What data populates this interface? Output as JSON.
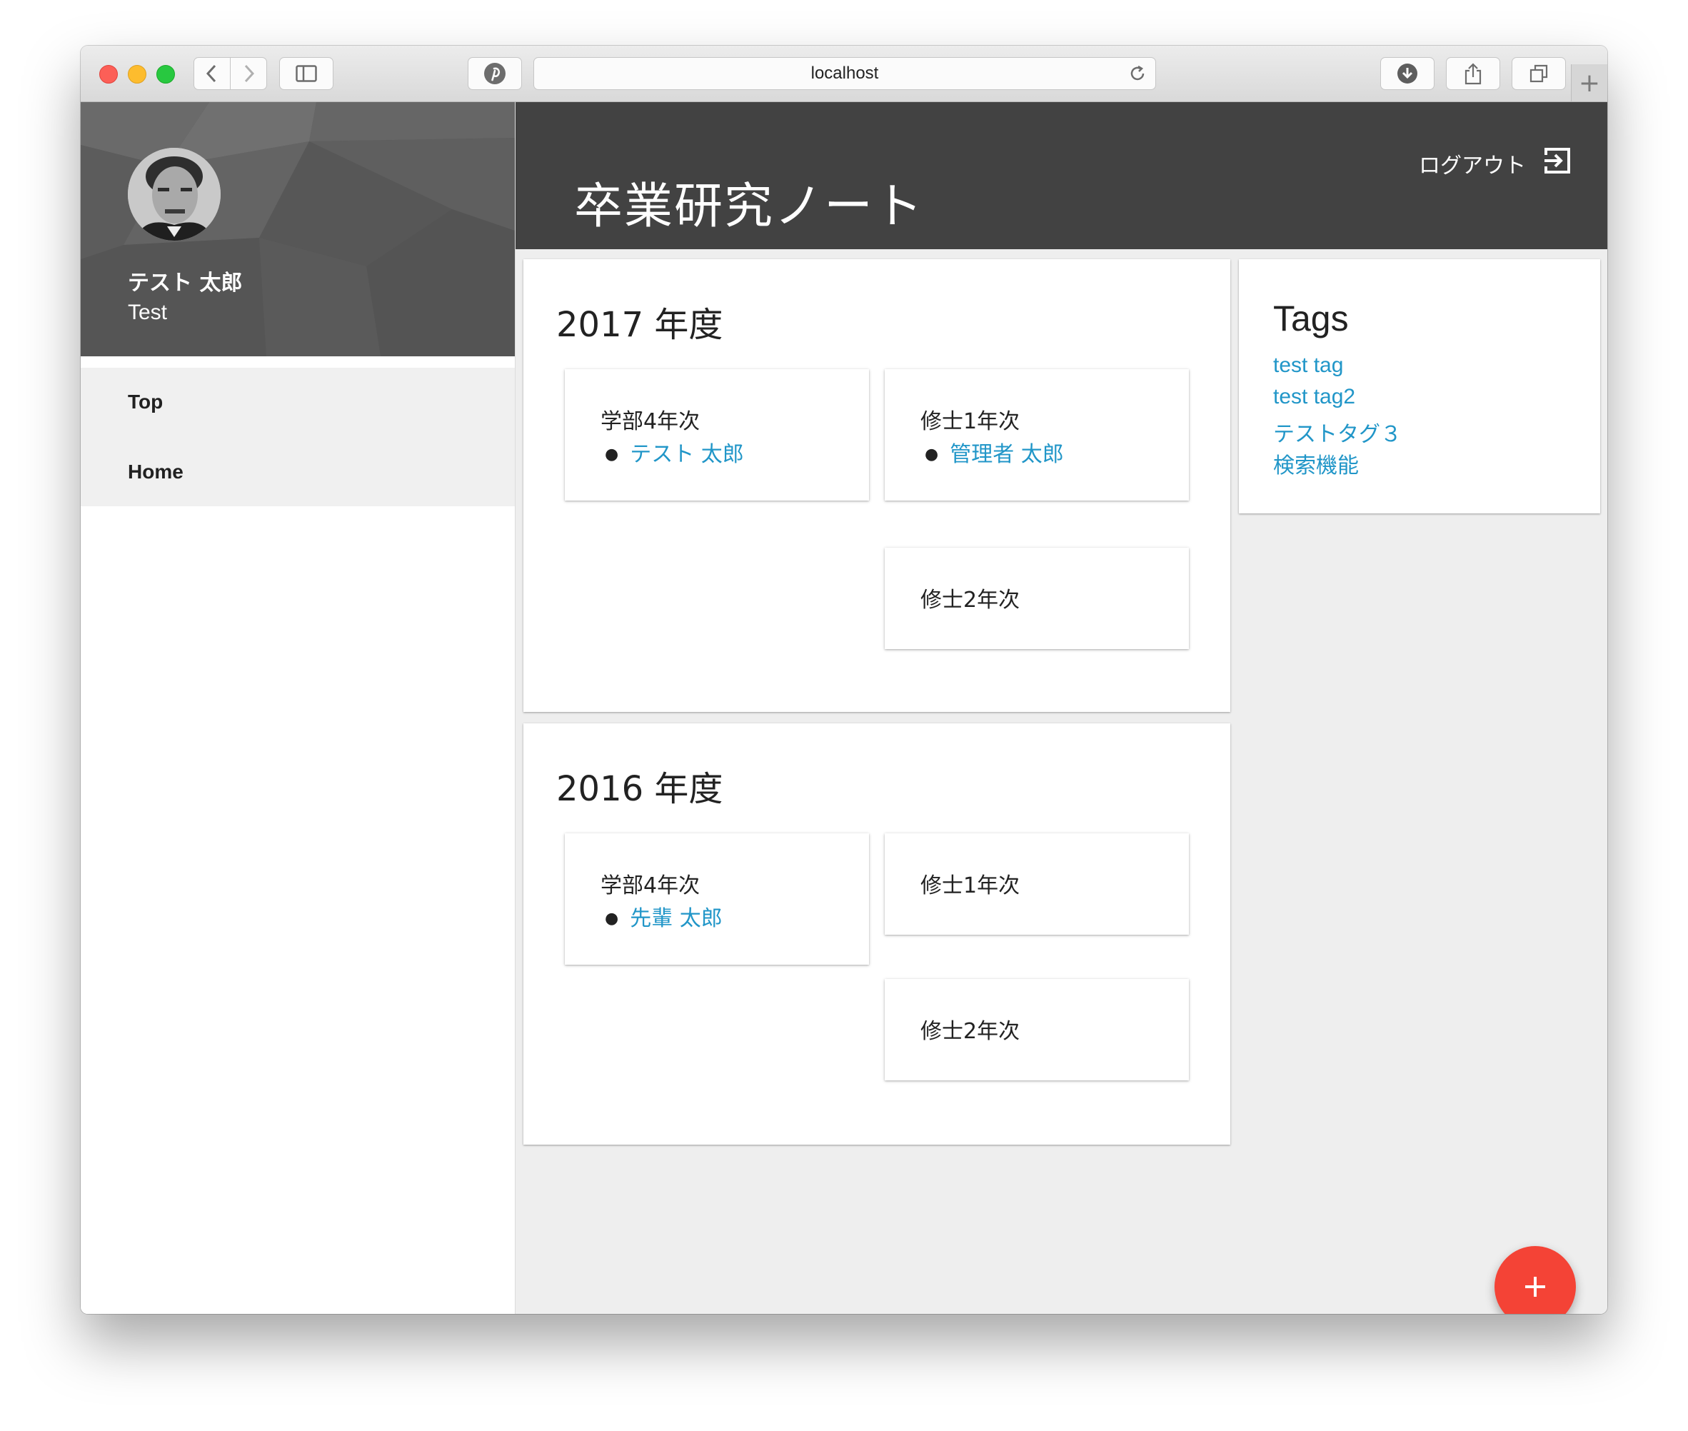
{
  "browser": {
    "url": "localhost",
    "traffic_colors": {
      "close": "#fc5f57",
      "minimize": "#fdbc2e",
      "zoom": "#28c840"
    }
  },
  "drawer": {
    "user_name": "テスト 太郎",
    "user_role": "Test",
    "nav_items": [
      {
        "label": "Top"
      },
      {
        "label": "Home"
      }
    ]
  },
  "appbar": {
    "title": "卒業研究ノート",
    "logout_label": "ログアウト"
  },
  "years": [
    {
      "title": "2017 年度",
      "grades": [
        {
          "label": "学部4年次",
          "members": [
            "テスト 太郎"
          ]
        },
        {
          "label": "修士1年次",
          "members": [
            "管理者 太郎"
          ]
        },
        {
          "label": "修士2年次",
          "members": []
        }
      ]
    },
    {
      "title": "2016 年度",
      "grades": [
        {
          "label": "学部4年次",
          "members": [
            "先輩 太郎"
          ]
        },
        {
          "label": "修士1年次",
          "members": []
        },
        {
          "label": "修士2年次",
          "members": []
        }
      ]
    }
  ],
  "tags_panel": {
    "title": "Tags",
    "tags": [
      "test tag",
      "test tag2",
      "テストタグ３",
      "検索機能"
    ]
  },
  "fab": {
    "icon": "plus-icon",
    "color": "#f44336"
  },
  "colors": {
    "appbar": "#424242",
    "link": "#2196c8",
    "background": "#eeeeee"
  }
}
